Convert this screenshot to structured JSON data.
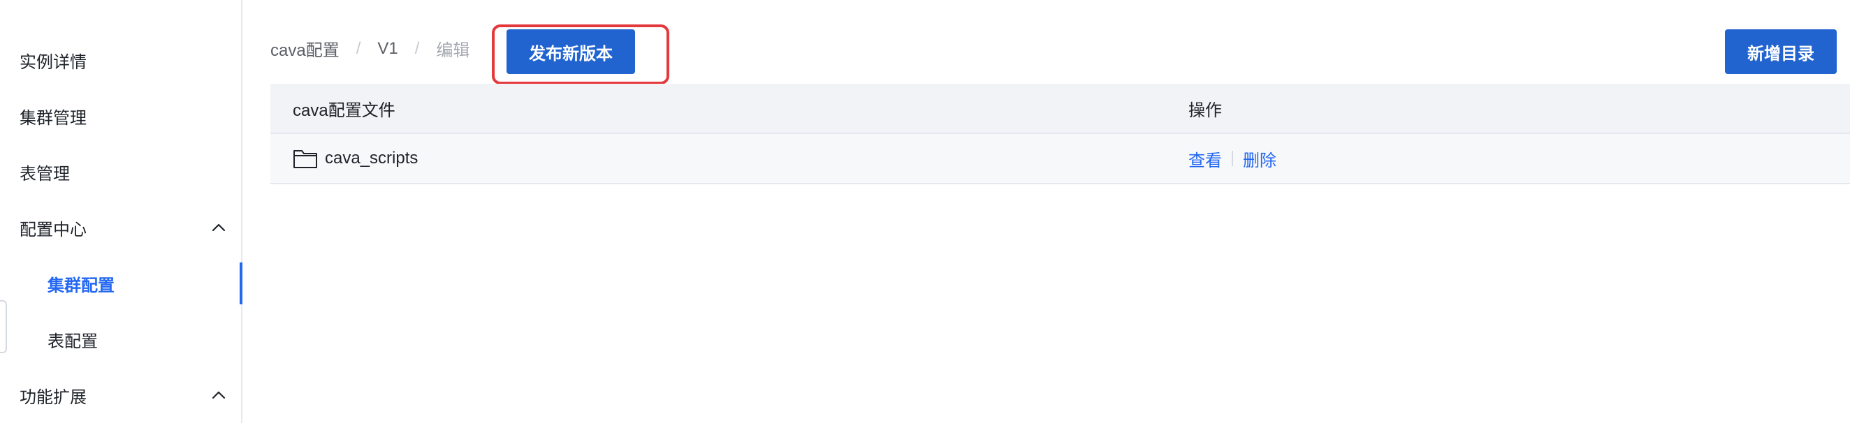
{
  "sidebar": {
    "items": [
      {
        "label": "实例详情"
      },
      {
        "label": "集群管理"
      },
      {
        "label": "表管理"
      },
      {
        "label": "配置中心"
      },
      {
        "label": "集群配置"
      },
      {
        "label": "表配置"
      },
      {
        "label": "功能扩展"
      }
    ],
    "active_item": "集群配置",
    "expand_icon": "chevron-up-icon"
  },
  "breadcrumb": {
    "items": [
      "cava配置",
      "V1",
      "编辑"
    ],
    "separator": "/"
  },
  "toolbar": {
    "publish_label": "发布新版本",
    "add_dir_label": "新增目录"
  },
  "table": {
    "columns": [
      "cava配置文件",
      "操作"
    ],
    "rows": [
      {
        "name": "cava_scripts",
        "icon": "folder-icon",
        "actions": [
          "查看",
          "删除"
        ]
      }
    ]
  },
  "colors": {
    "accent": "#2468f2",
    "primary_button": "#2164d0",
    "highlight_border": "#e4393c",
    "header_bg": "#f1f3f7"
  }
}
